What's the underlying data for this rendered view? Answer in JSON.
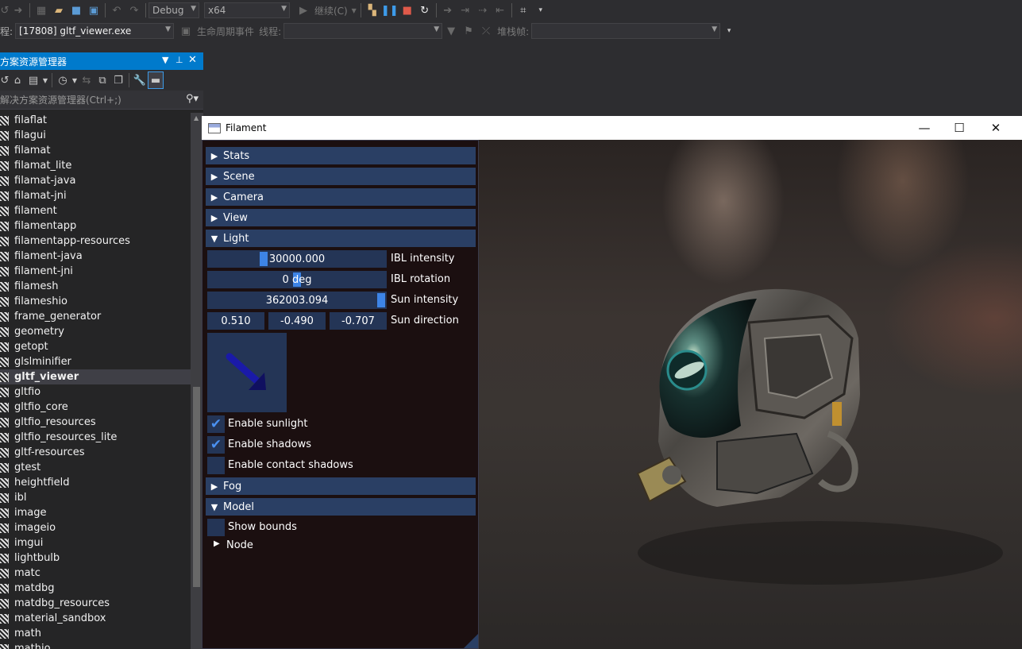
{
  "toolbar1": {
    "config_value": "Debug",
    "platform_value": "x64",
    "continue_label": "继续(C)"
  },
  "toolbar2": {
    "process_label": "程:",
    "process_value": "[17808] gltf_viewer.exe",
    "lifecycle_label": "生命周期事件",
    "thread_label": "线程:",
    "stackframe_label": "堆栈帧:"
  },
  "solution_explorer": {
    "title": "方案资源管理器",
    "search_placeholder": "解决方案资源管理器(Ctrl+;)",
    "items": [
      "filaflat",
      "filagui",
      "filamat",
      "filamat_lite",
      "filamat-java",
      "filamat-jni",
      "filament",
      "filamentapp",
      "filamentapp-resources",
      "filament-java",
      "filament-jni",
      "filamesh",
      "filameshio",
      "frame_generator",
      "geometry",
      "getopt",
      "glslminifier",
      "gltf_viewer",
      "gltfio",
      "gltfio_core",
      "gltfio_resources",
      "gltfio_resources_lite",
      "gltf-resources",
      "gtest",
      "heightfield",
      "ibl",
      "image",
      "imageio",
      "imgui",
      "lightbulb",
      "matc",
      "matdbg",
      "matdbg_resources",
      "material_sandbox",
      "math",
      "mathio"
    ],
    "selected_item": "gltf_viewer"
  },
  "filament_window": {
    "title": "Filament",
    "headers": {
      "stats": "Stats",
      "scene": "Scene",
      "camera": "Camera",
      "view": "View",
      "light": "Light",
      "fog": "Fog",
      "model": "Model"
    },
    "light": {
      "ibl_intensity_value": "30000.000",
      "ibl_intensity_label": "IBL intensity",
      "ibl_rotation_value": "0 deg",
      "ibl_rotation_label": "IBL rotation",
      "sun_intensity_value": "362003.094",
      "sun_intensity_label": "Sun intensity",
      "sun_direction": [
        "0.510",
        "-0.490",
        "-0.707"
      ],
      "sun_direction_label": "Sun direction",
      "enable_sunlight_label": "Enable sunlight",
      "enable_sunlight": true,
      "enable_shadows_label": "Enable shadows",
      "enable_shadows": true,
      "enable_contact_shadows_label": "Enable contact shadows",
      "enable_contact_shadows": false
    },
    "model": {
      "show_bounds_label": "Show bounds",
      "show_bounds": false,
      "node_label": "Node"
    }
  },
  "colors": {
    "accent": "#007acc",
    "imgui_header": "#2a3f64",
    "imgui_frame": "#243556",
    "imgui_check": "#4a90f0"
  }
}
